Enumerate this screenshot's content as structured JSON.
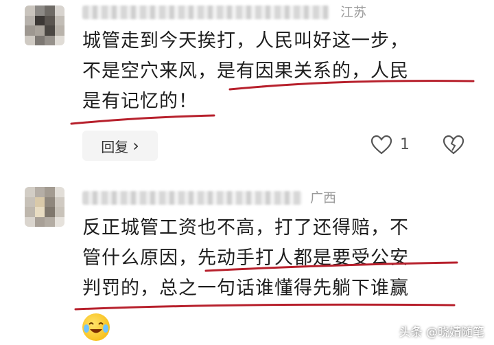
{
  "comments": [
    {
      "region": "江苏",
      "lines": [
        "城管走到今天挨打，人民叫好这一步，",
        "不是空穴来风，是有因果关系的，人民",
        "是有记忆的！"
      ],
      "reply_label": "回复",
      "reply_chevron": "›",
      "like_count": "1",
      "like_icon": "heart-outline-icon",
      "dislike_icon": "broken-heart-icon"
    },
    {
      "region": "广西",
      "lines": [
        "反正城管工资也不高，打了还得赔，不",
        "管什么原因，先动手打人都是要受公安",
        "判罚的，总之一句话谁懂得先躺下谁赢"
      ],
      "emoji_icon": "laughing-crying-emoji-icon"
    }
  ],
  "watermark": "头条 @晓婧随笔",
  "colors": {
    "underline": "#b7202c",
    "region": "#9b9b9b",
    "text": "#1e1e1e"
  }
}
